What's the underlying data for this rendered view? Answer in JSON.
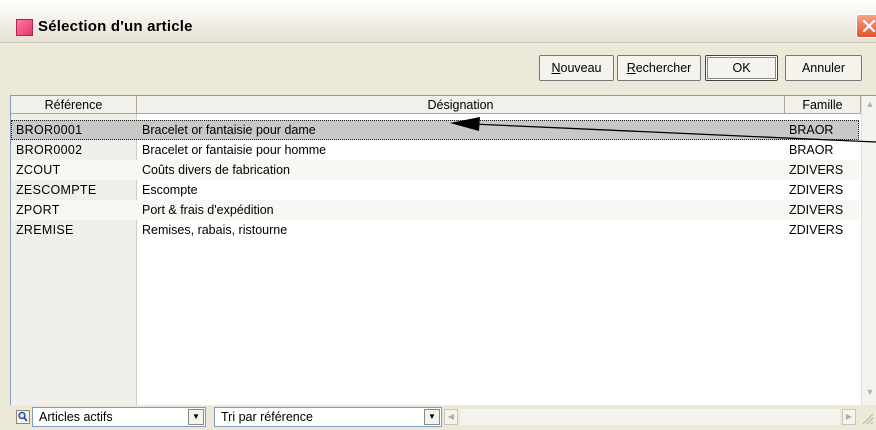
{
  "window": {
    "title": "Sélection d'un article"
  },
  "toolbar": {
    "new_label_u": "N",
    "new_label_rest": "ouveau",
    "search_label_u": "R",
    "search_label_rest": "echercher",
    "ok_label": "OK",
    "cancel_label": "Annuler"
  },
  "table": {
    "headers": [
      "Référence",
      "Désignation",
      "Famille"
    ],
    "rows": [
      {
        "ref": "BROR0001",
        "designation": "Bracelet or fantaisie pour dame",
        "famille": "BRAOR"
      },
      {
        "ref": "BROR0002",
        "designation": "Bracelet or fantaisie pour homme",
        "famille": "BRAOR"
      },
      {
        "ref": "ZCOUT",
        "designation": "Coûts divers de fabrication",
        "famille": "ZDIVERS"
      },
      {
        "ref": "ZESCOMPTE",
        "designation": "Escompte",
        "famille": "ZDIVERS"
      },
      {
        "ref": "ZPORT",
        "designation": "Port & frais d'expédition",
        "famille": "ZDIVERS"
      },
      {
        "ref": "ZREMISE",
        "designation": "Remises, rabais, ristourne",
        "famille": "ZDIVERS"
      }
    ],
    "selected_row": 0
  },
  "filters": {
    "status_filter": "Articles actifs",
    "sort_order": "Tri par référence"
  },
  "icons": {
    "app": "app-icon",
    "close": "close-icon",
    "filter": "magnifier-icon",
    "dropdown": "chevron-down-icon"
  },
  "colors": {
    "window_bg": "#ece9d8",
    "selected_row_bg": "#c8c8c8",
    "close_button": "#e2532c",
    "app_icon": "#e4346f"
  }
}
